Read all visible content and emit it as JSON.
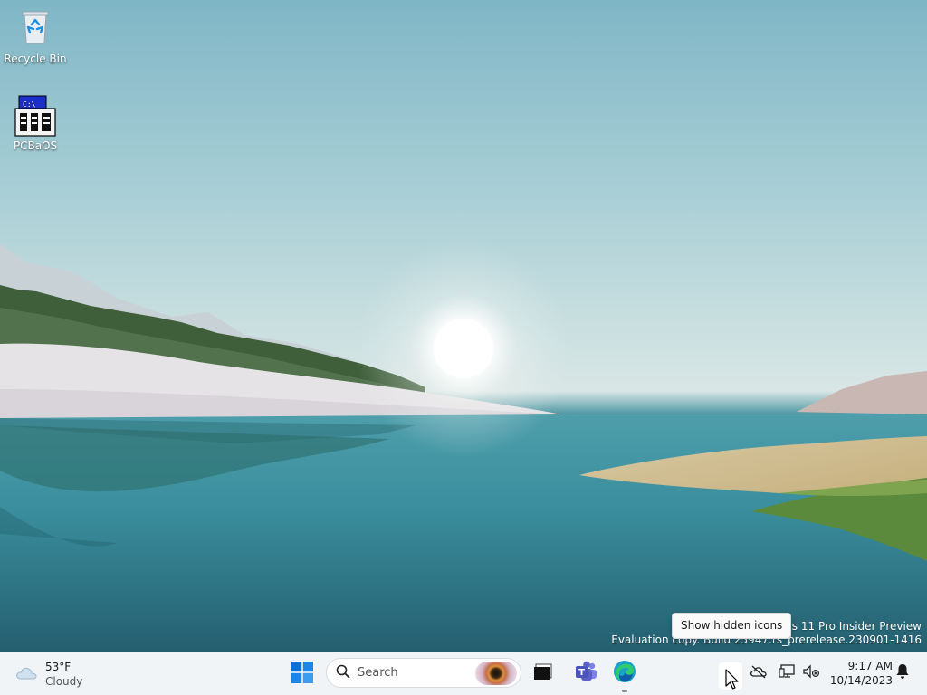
{
  "desktop": {
    "icons": [
      {
        "label": "Recycle Bin",
        "icon": "recycle-bin-icon"
      },
      {
        "label": "PCBaOS",
        "icon": "pcbaos-app-icon"
      }
    ]
  },
  "watermark": {
    "line1": "indows 11 Pro Insider Preview",
    "line2": "Evaluation copy. Build 25947.rs_prerelease.230901-1416"
  },
  "tooltip": {
    "text": "Show hidden icons"
  },
  "taskbar": {
    "weather": {
      "temp": "53°F",
      "condition": "Cloudy",
      "icon": "cloud-icon"
    },
    "search": {
      "placeholder": "Search",
      "icon": "search-icon"
    },
    "pinned": [
      {
        "name": "start",
        "icon": "windows-start-icon"
      },
      {
        "name": "task-view",
        "icon": "task-view-icon"
      },
      {
        "name": "teams",
        "icon": "teams-icon"
      },
      {
        "name": "edge",
        "icon": "edge-icon"
      }
    ],
    "tray": {
      "icons": [
        "chevron-up-icon",
        "cloud-offline-icon",
        "network-icon",
        "volume-muted-icon",
        "bell-icon"
      ],
      "time": "9:17 AM",
      "date": "10/14/2023"
    }
  },
  "colors": {
    "taskbar_bg": "#f1f4f6",
    "start_blue": "#0a6fd6",
    "teams_purple": "#5b5fc7",
    "edge_teal": "#1aa0c9"
  }
}
